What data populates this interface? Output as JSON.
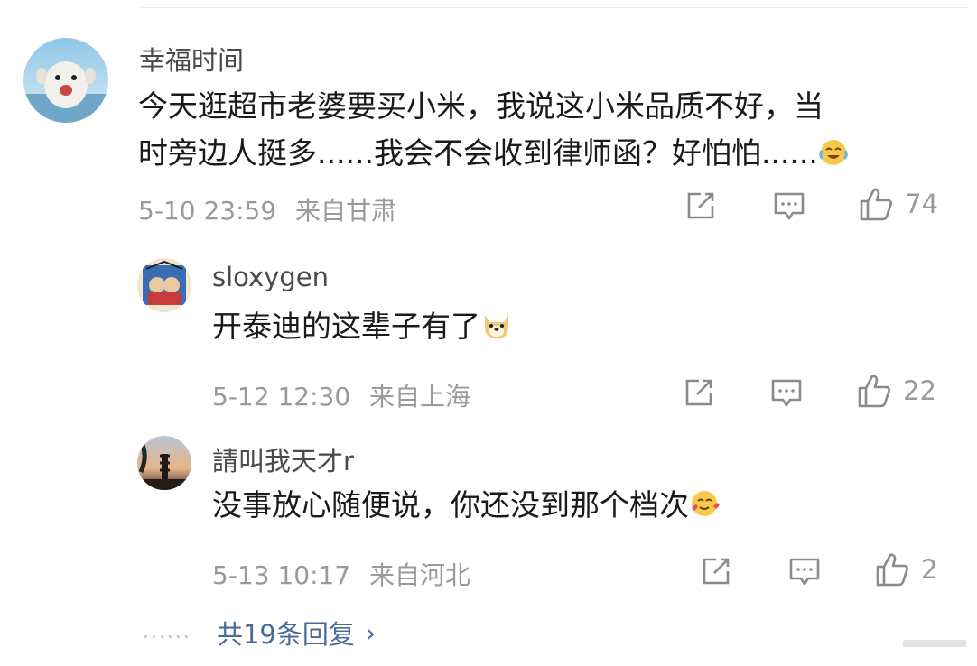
{
  "comment": {
    "username": "幸福时间",
    "text_line1": "今天逛超市老婆要买小米，我说这小米品质不好，当",
    "text_line2": "时旁边人挺多......我会不会收到律师函？好怕怕......",
    "emoji_icon": "laugh-cry-emoji-icon",
    "time": "5-10 23:59",
    "location": "来自甘肃",
    "like_count": "74"
  },
  "replies": [
    {
      "username": "sloxygen",
      "text": "开泰迪的这辈子有了",
      "emoji_icon": "doge-emoji-icon",
      "time": "5-12 12:30",
      "location": "来自上海",
      "like_count": "22"
    },
    {
      "username": "請叫我天才r",
      "text": "没事放心随便说，你还没到那个档次",
      "emoji_icon": "hearts-face-emoji-icon",
      "time": "5-13 10:17",
      "location": "来自河北",
      "like_count": "2"
    }
  ],
  "more": {
    "dots": "......",
    "label": "共19条回复",
    "chevron": "›"
  },
  "colors": {
    "text": "#1a1a1a",
    "meta": "#9a9a9a",
    "link": "#4a6a99",
    "icon": "#8a8a8a"
  }
}
